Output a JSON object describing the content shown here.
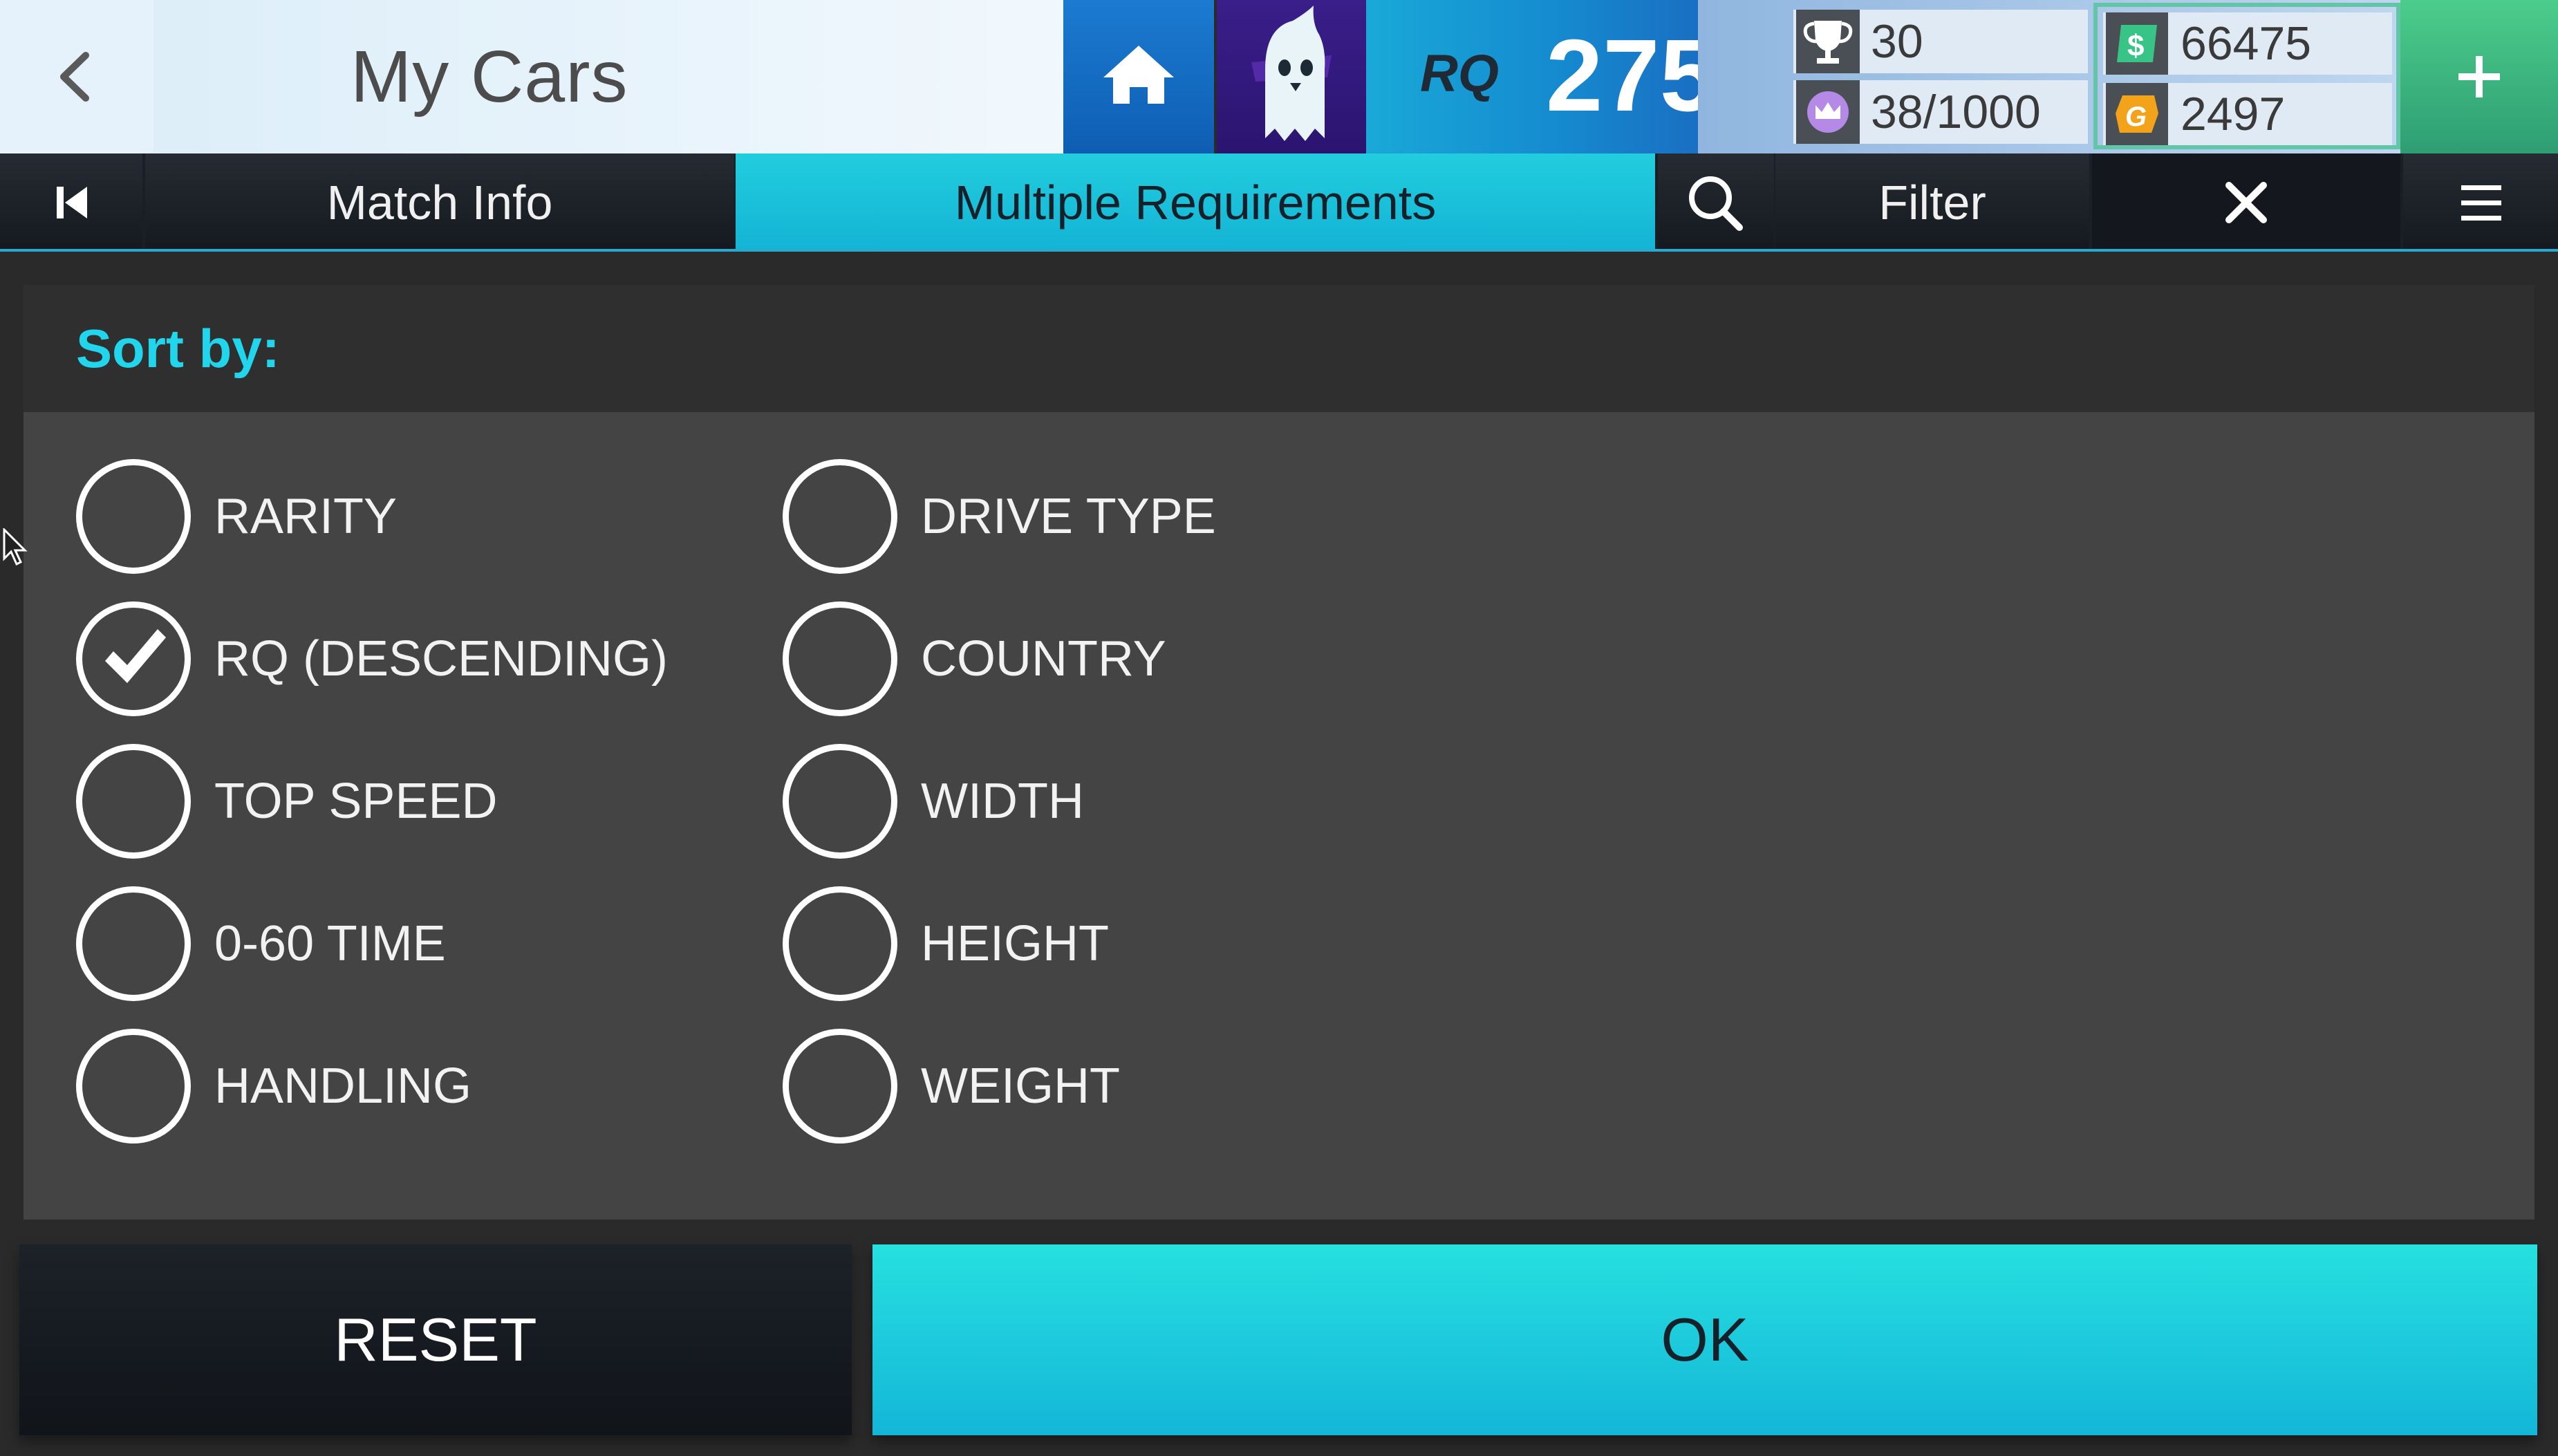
{
  "header": {
    "title": "My Cars",
    "rq_logo": "RQ",
    "rq_value": "275",
    "trophies": "30",
    "crowns": "38/1000",
    "cash": "66475",
    "gold": "2497",
    "icons": [
      "back-icon",
      "home-icon",
      "avatar-ghost",
      "trophy-icon",
      "crown-icon",
      "cash-icon",
      "gold-icon",
      "plus-icon"
    ]
  },
  "tabs": {
    "match_info": "Match Info",
    "multiple_requirements": "Multiple Requirements",
    "filter": "Filter",
    "icons": [
      "skip-back-icon",
      "search-icon",
      "close-icon",
      "menu-icon"
    ]
  },
  "sort": {
    "title": "Sort by:",
    "left_options": [
      {
        "label": "RARITY",
        "checked": false
      },
      {
        "label": "RQ (DESCENDING)",
        "checked": true
      },
      {
        "label": "TOP SPEED",
        "checked": false
      },
      {
        "label": "0-60 TIME",
        "checked": false
      },
      {
        "label": "HANDLING",
        "checked": false
      }
    ],
    "right_options": [
      {
        "label": "DRIVE TYPE",
        "checked": false
      },
      {
        "label": "COUNTRY",
        "checked": false
      },
      {
        "label": "WIDTH",
        "checked": false
      },
      {
        "label": "HEIGHT",
        "checked": false
      },
      {
        "label": "WEIGHT",
        "checked": false
      }
    ]
  },
  "buttons": {
    "reset": "RESET",
    "ok": "OK"
  },
  "colors": {
    "accent_cyan": "#21d6ec",
    "ok_button": "#1fcde0",
    "panel": "#444444",
    "header_blue": "#1589cf",
    "plus_green": "#3fb783"
  }
}
